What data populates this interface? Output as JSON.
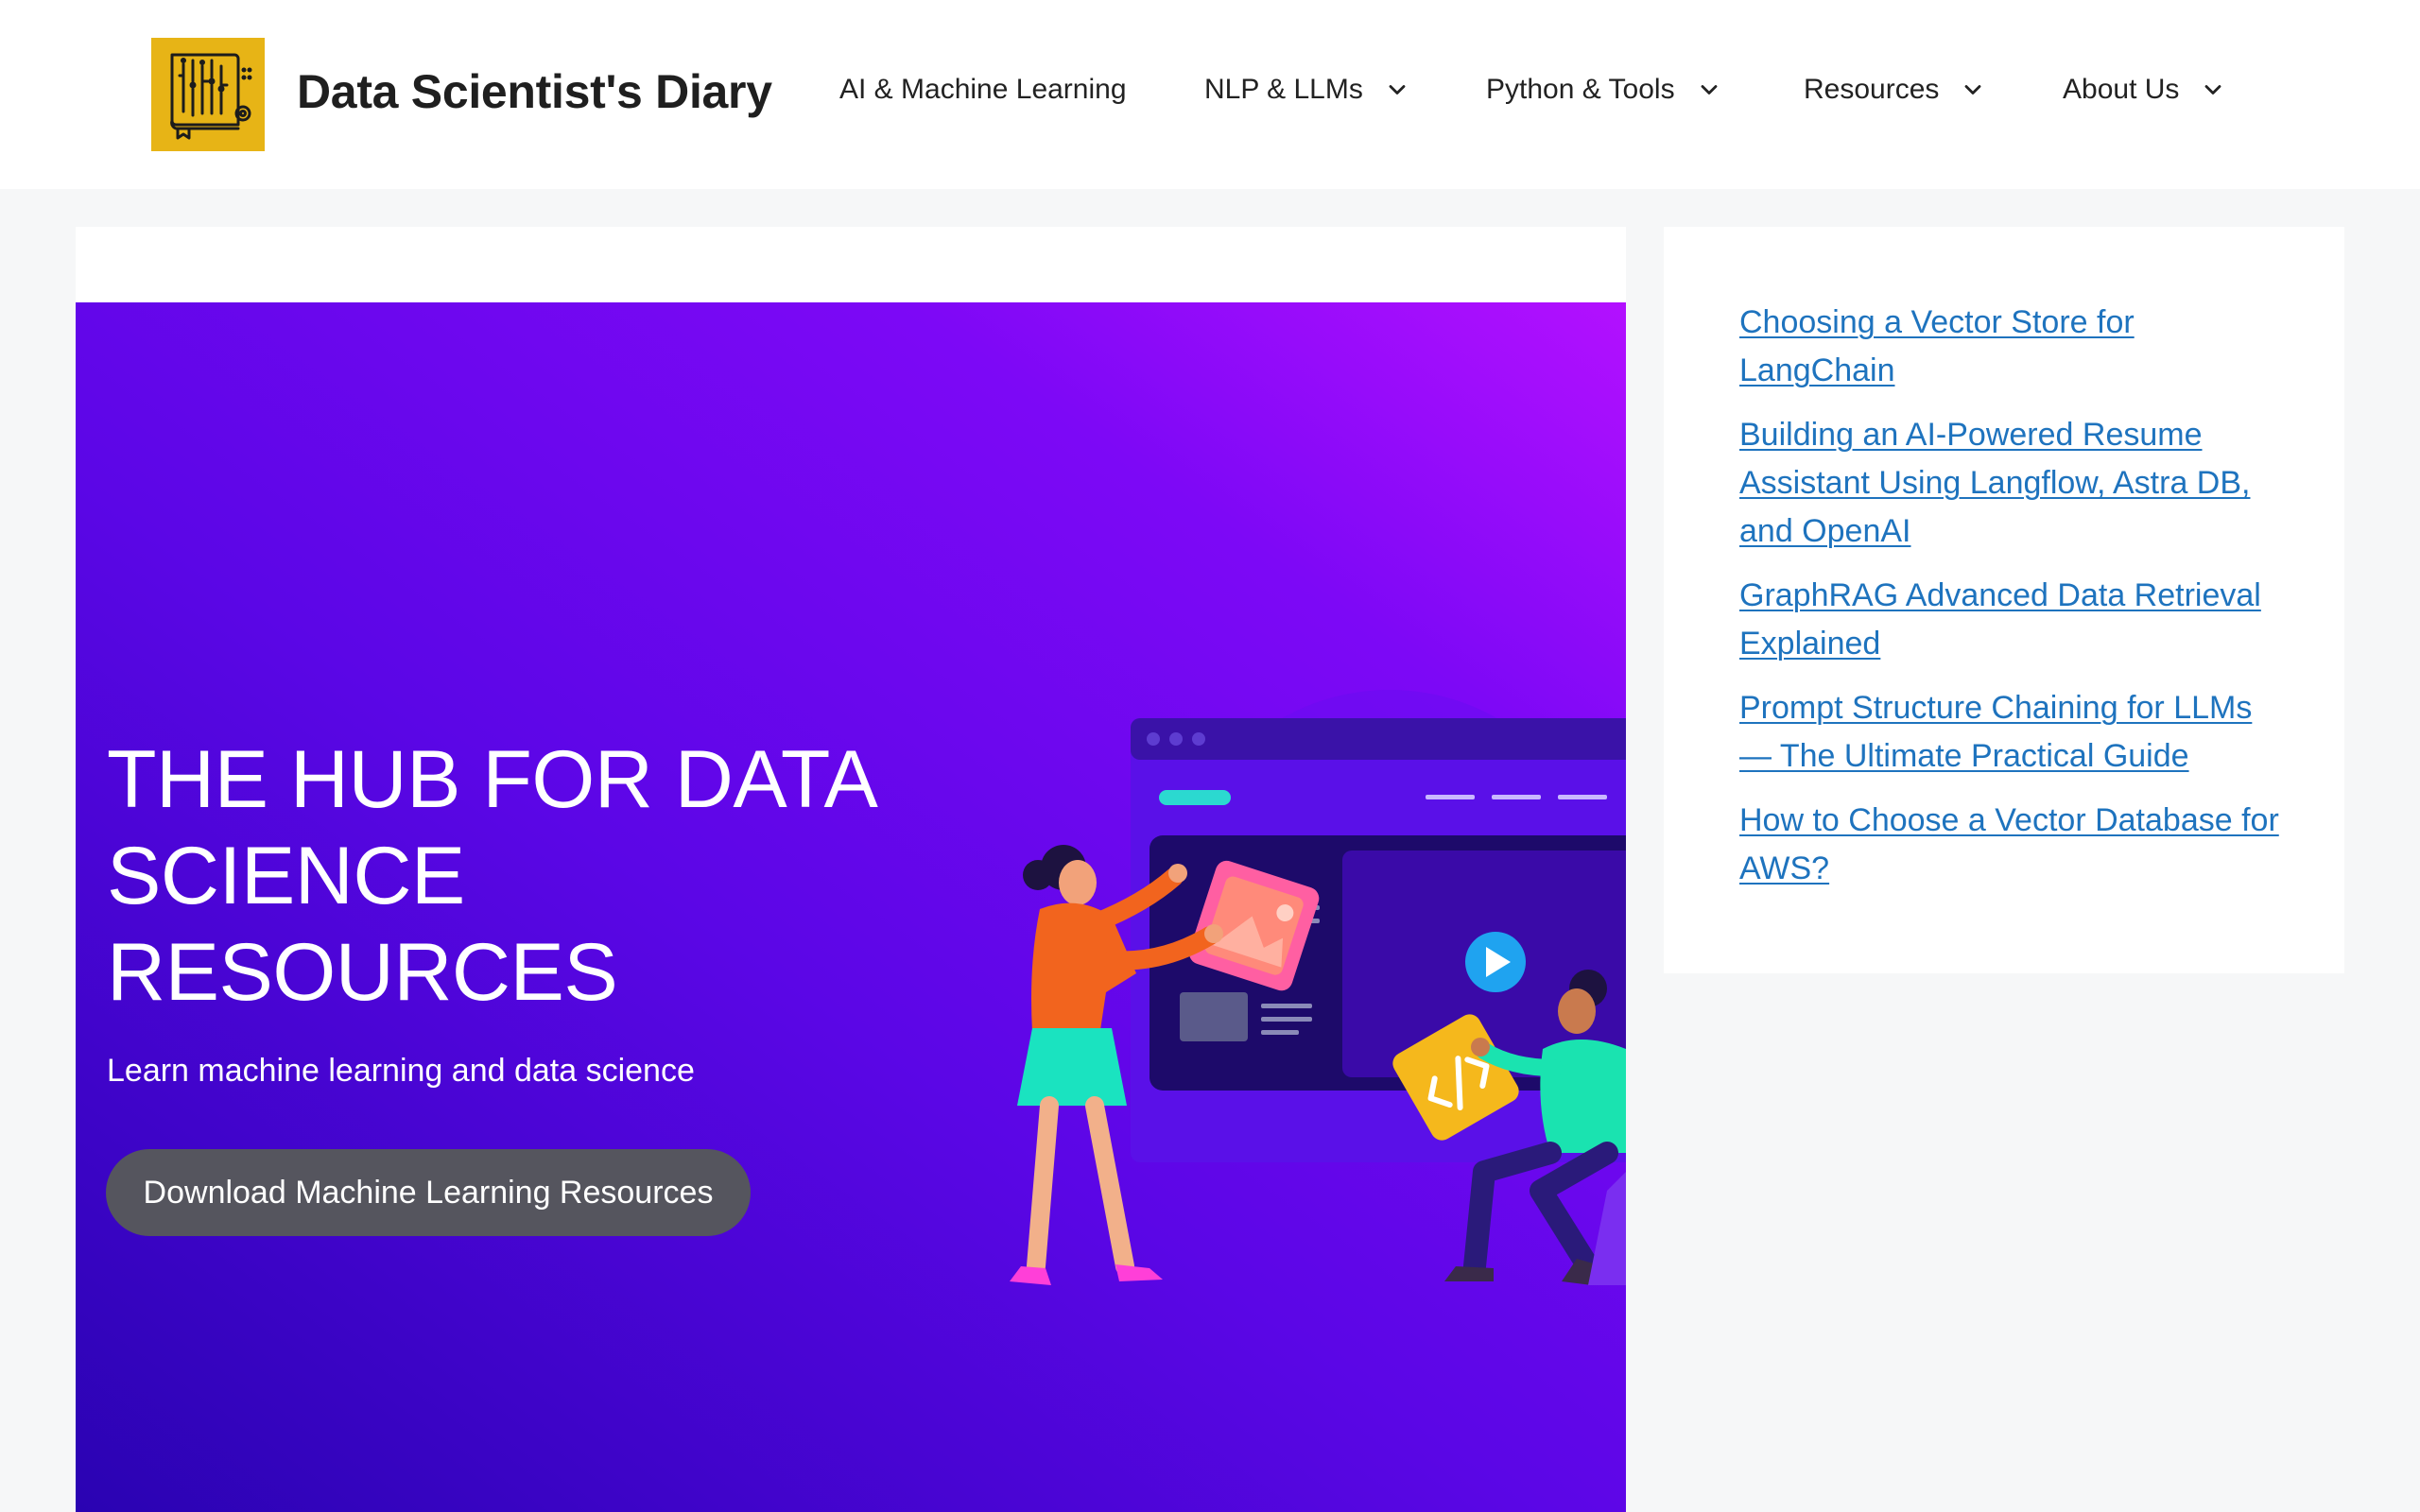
{
  "header": {
    "site_title": "Data Scientist's Diary",
    "logo_icon": "circuit-book-icon",
    "logo_color": "#e7b416",
    "nav": [
      {
        "label": "AI & Machine Learning",
        "has_dropdown": false
      },
      {
        "label": "NLP & LLMs",
        "has_dropdown": true
      },
      {
        "label": "Python & Tools",
        "has_dropdown": true
      },
      {
        "label": "Resources",
        "has_dropdown": true
      },
      {
        "label": "About Us",
        "has_dropdown": true
      }
    ]
  },
  "hero": {
    "title": "THE HUB FOR DATA SCIENCE RESOURCES",
    "subtitle": "Learn machine learning and data science",
    "button_label": "Download Machine Learning Resources",
    "gradient_colors": [
      "#b310ff",
      "#5b06e6",
      "#2a03b2"
    ],
    "button_color": "#55555e"
  },
  "sidebar": {
    "recent_posts": [
      "Choosing a Vector Store for LangChain",
      "Building an AI-Powered Resume Assistant Using Langflow, Astra DB, and OpenAI",
      "GraphRAG Advanced Data Retrieval Explained",
      "Prompt Structure Chaining for LLMs — The Ultimate Practical Guide",
      "How to Choose a Vector Database for AWS?"
    ],
    "link_color": "#1e73be"
  }
}
